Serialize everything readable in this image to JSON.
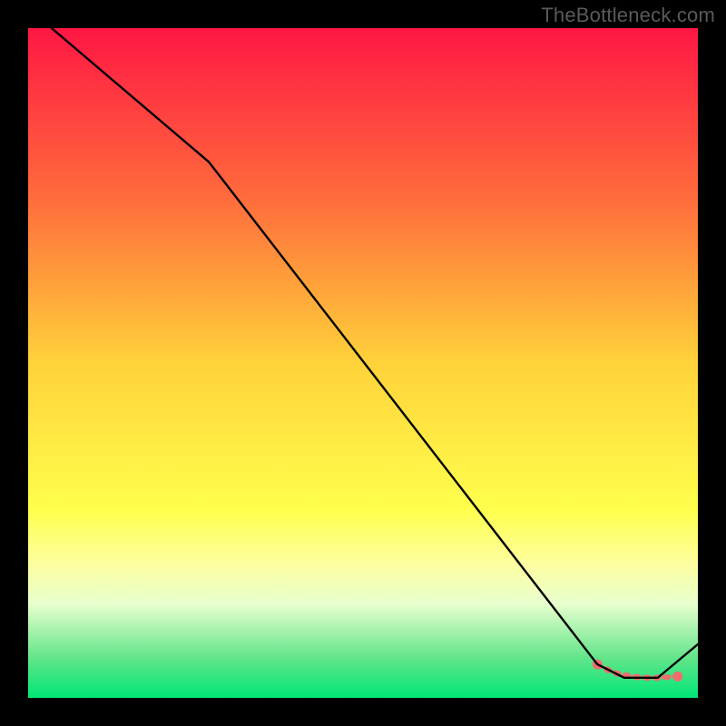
{
  "watermark": "TheBottleneck.com",
  "chart_data": {
    "type": "line",
    "title": "",
    "xlabel": "",
    "ylabel": "",
    "xlim": [
      0,
      100
    ],
    "ylim": [
      0,
      100
    ],
    "gradient_stops": [
      {
        "offset": 0,
        "color": "#ff1744"
      },
      {
        "offset": 25,
        "color": "#ff6a3c"
      },
      {
        "offset": 50,
        "color": "#ffd23a"
      },
      {
        "offset": 72,
        "color": "#ffff4d"
      },
      {
        "offset": 80,
        "color": "#fdffa0"
      },
      {
        "offset": 86,
        "color": "#e7ffce"
      },
      {
        "offset": 94,
        "color": "#63e58a"
      },
      {
        "offset": 100,
        "color": "#00e676"
      }
    ],
    "series": [
      {
        "name": "curve",
        "x": [
          3.5,
          27,
          85,
          89,
          94,
          100
        ],
        "y": [
          100,
          80,
          5,
          3,
          3,
          8
        ]
      }
    ],
    "markers": {
      "name": "highlight-band",
      "x": [
        85,
        86.5,
        88,
        89.5,
        91,
        92.5,
        94,
        97
      ],
      "y": [
        5,
        4.2,
        3.6,
        3.3,
        3.1,
        3.0,
        3.0,
        3.2
      ],
      "color": "#f06d6d"
    }
  }
}
